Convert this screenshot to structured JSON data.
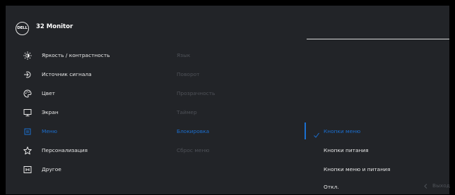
{
  "header": {
    "logo": "DELL",
    "title": "32 Monitor"
  },
  "main_menu": [
    {
      "label": "Яркость / контрастность",
      "icon": "brightness-icon"
    },
    {
      "label": "Источник сигнала",
      "icon": "input-source-icon"
    },
    {
      "label": "Цвет",
      "icon": "palette-icon"
    },
    {
      "label": "Экран",
      "icon": "display-icon"
    },
    {
      "label": "Меню",
      "icon": "menu-icon",
      "active": true
    },
    {
      "label": "Персонализация",
      "icon": "star-icon"
    },
    {
      "label": "Другое",
      "icon": "other-icon"
    }
  ],
  "submenu": [
    {
      "label": "Язык"
    },
    {
      "label": "Поворот"
    },
    {
      "label": "Прозрачность"
    },
    {
      "label": "Таймер"
    },
    {
      "label": "Блокировка",
      "active": true
    },
    {
      "label": "Сброс меню"
    }
  ],
  "options": [
    {
      "label": "Кнопки меню",
      "selected": true
    },
    {
      "label": "Кнопки питания"
    },
    {
      "label": "Кнопки меню и питания"
    },
    {
      "label": "Откл."
    }
  ],
  "footer": {
    "exit_label": "Выход"
  },
  "colors": {
    "accent": "#1b6fd0",
    "panel": "#222428",
    "dim_text": "#4e5157",
    "text": "#e8e8e8"
  }
}
